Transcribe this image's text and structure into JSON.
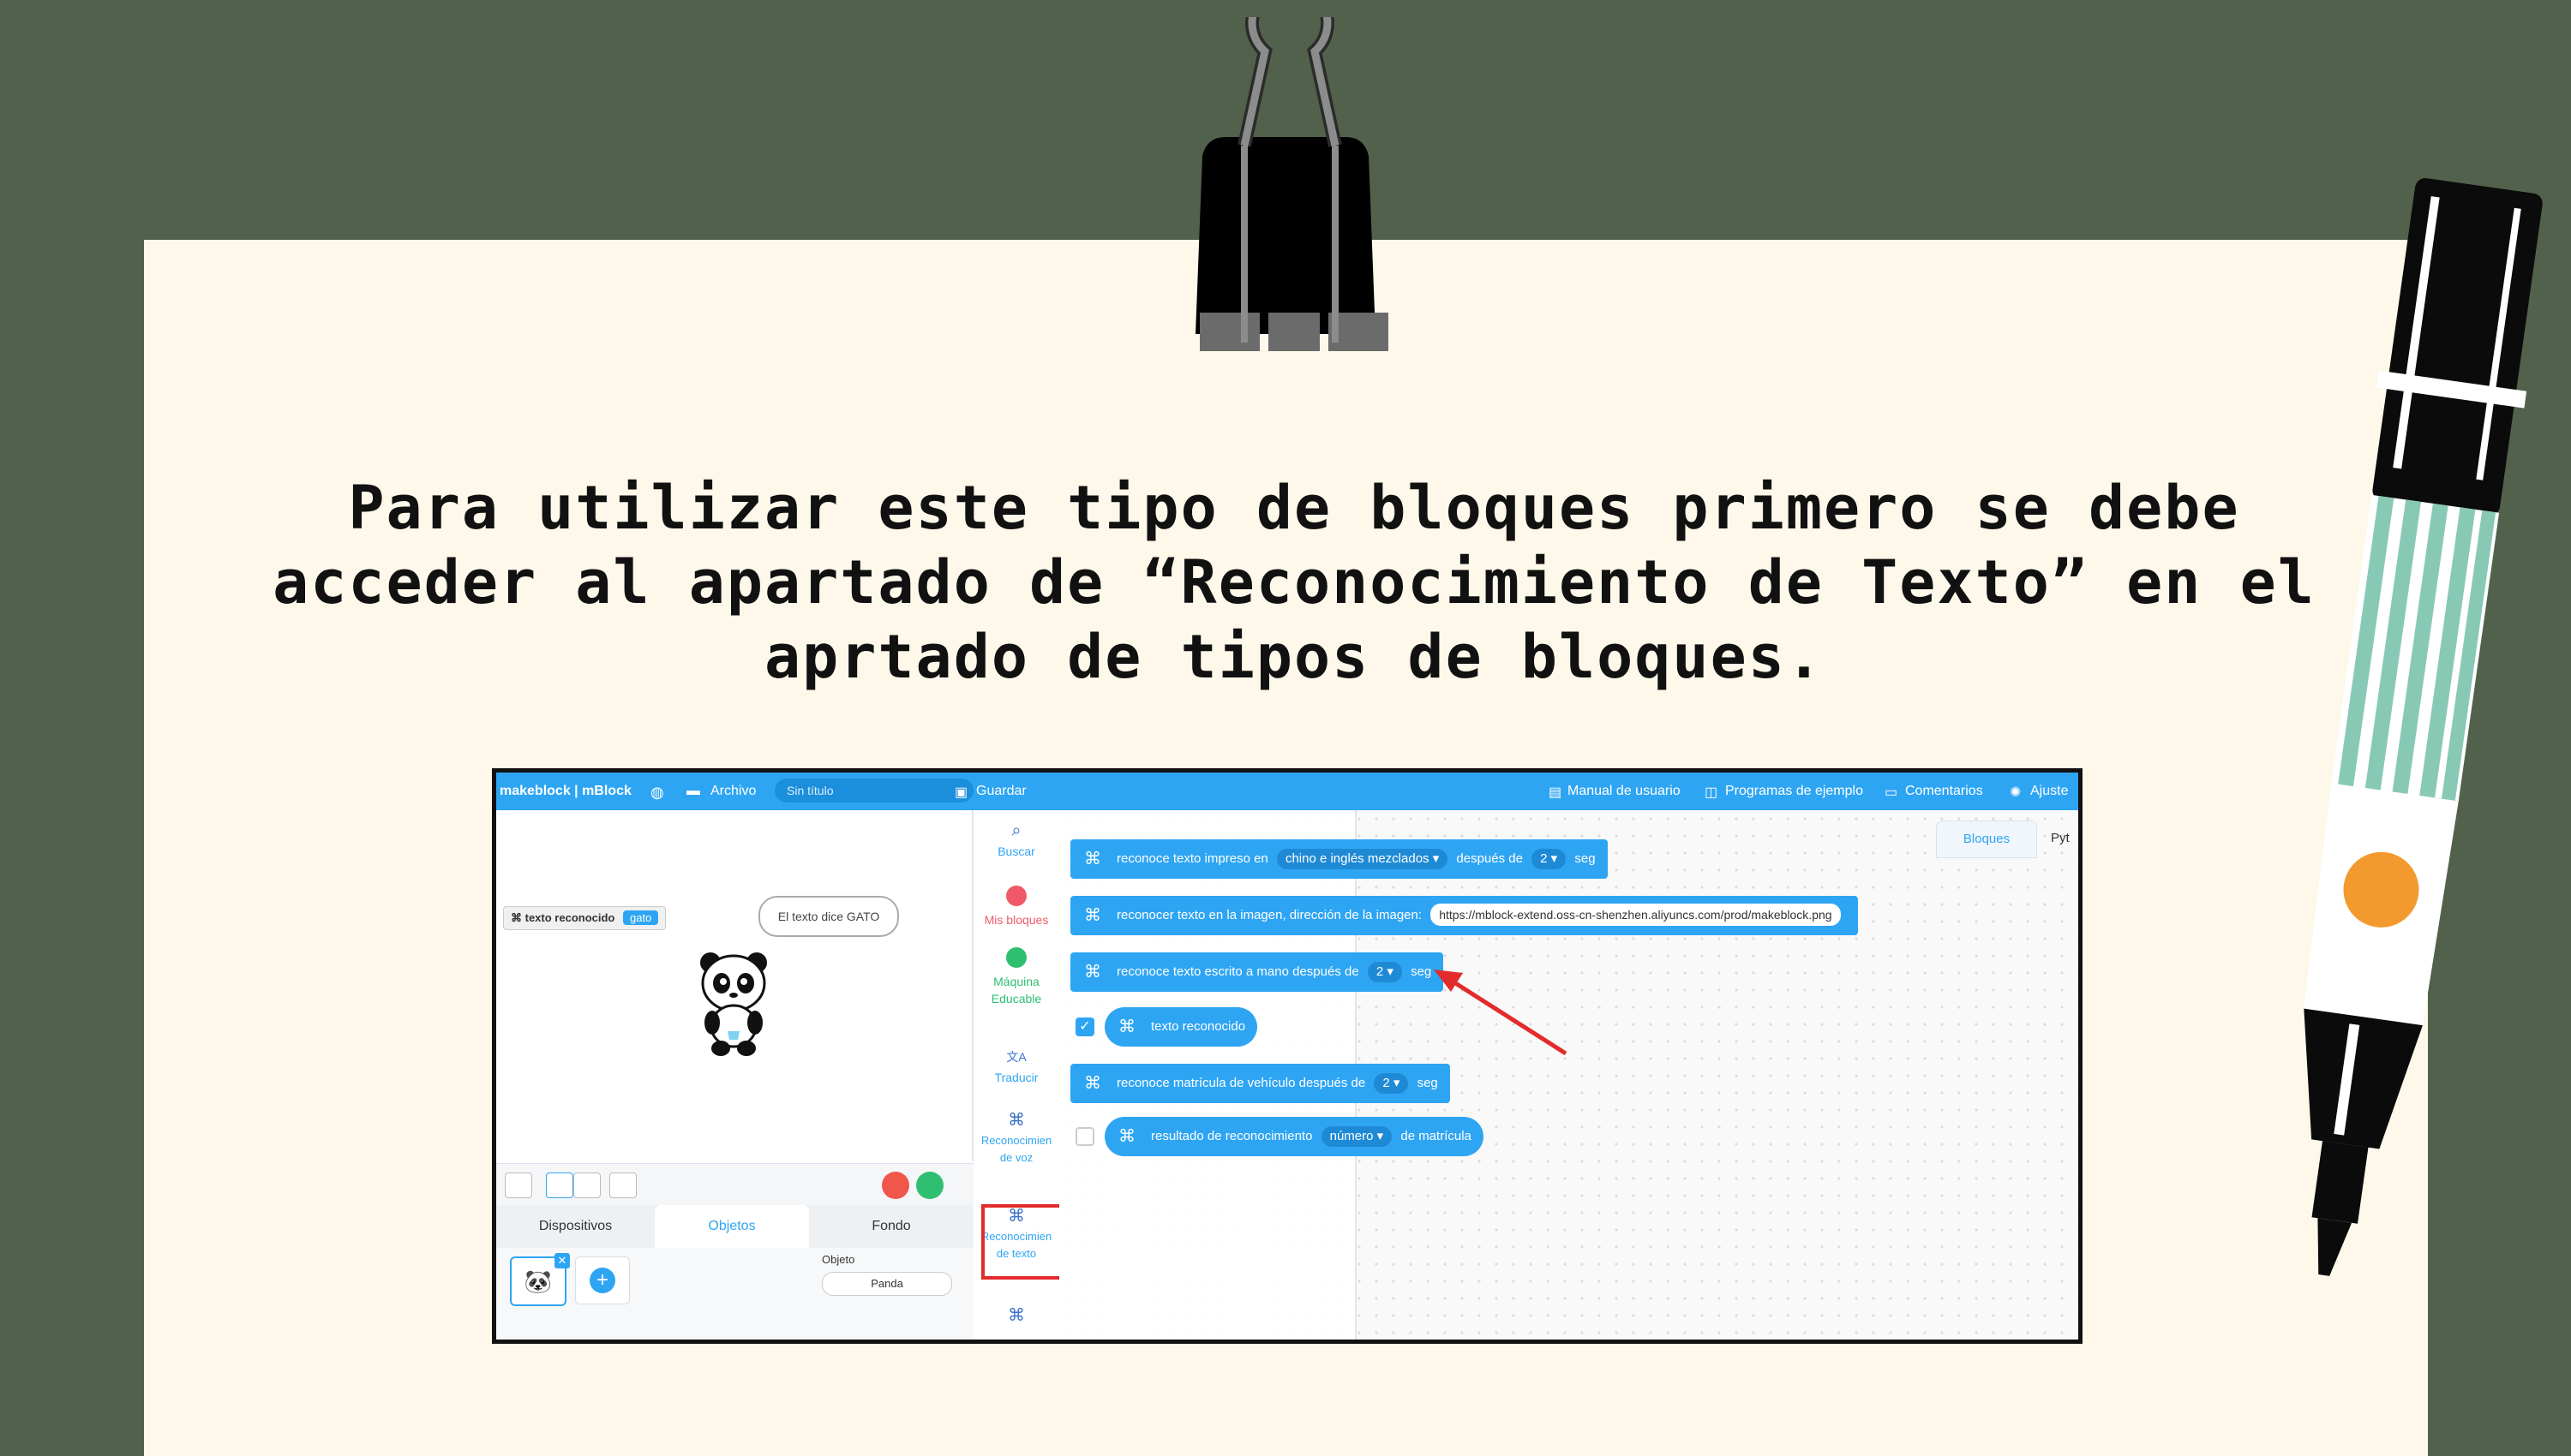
{
  "heading": {
    "line1": "Para utilizar este tipo de bloques primero se debe",
    "line2": "acceder al apartado de “Reconocimiento de Texto” en el",
    "line3": "aprtado de tipos de bloques."
  },
  "colors": {
    "background": "#52614c",
    "paper": "#fef8ea",
    "app_blue": "#2ea5f3",
    "highlight_red": "#e32b2b",
    "marker_stripes": "#88c9b5",
    "marker_dot": "#f29a2e"
  },
  "app": {
    "topbar": {
      "brand": "makeblock | mBlock",
      "file_menu": "Archivo",
      "project_title": "Sin título",
      "save": "Guardar",
      "manual": "Manual de usuario",
      "examples": "Programas de ejemplo",
      "comments": "Comentarios",
      "settings": "Ajuste",
      "icons": [
        "globe-icon",
        "folder-icon",
        "save-icon",
        "book-icon",
        "examples-icon",
        "comment-icon",
        "gear-icon"
      ]
    },
    "stage": {
      "variable_label": "texto reconocido",
      "variable_value": "gato",
      "speech": "El texto dice GATO"
    },
    "panel_tabs": [
      "Dispositivos",
      "Objetos",
      "Fondo"
    ],
    "sprite_panel": {
      "object_label": "Objeto",
      "object_name": "Panda"
    },
    "categories": [
      {
        "label1": "Buscar",
        "label2": "",
        "icon": "search-icon"
      },
      {
        "label1": "Mis bloques",
        "label2": "",
        "color": "#f05a68"
      },
      {
        "label1": "Máquina",
        "label2": "Educable",
        "color": "#2fbf71"
      },
      {
        "label1": "Traducir",
        "label2": "",
        "icon": "translate-icon"
      },
      {
        "label1": "Reconocimien",
        "label2": "de voz",
        "icon": "voice-recognition-icon"
      },
      {
        "label1": "Reconocimien",
        "label2": "de texto",
        "icon": "text-recognition-icon"
      }
    ],
    "blocks": [
      {
        "pre": "reconoce texto impreso en",
        "dd1": "chino e inglés mezclados ▾",
        "mid": "después de",
        "dd2": "2 ▾",
        "post": "seg"
      },
      {
        "pre": "reconocer texto en la imagen, dirección de la imagen:",
        "url": "https://mblock-extend.oss-cn-shenzhen.aliyuncs.com/prod/makeblock.png"
      },
      {
        "pre": "reconoce texto escrito a mano después de",
        "dd2": "2 ▾",
        "post": "seg"
      },
      {
        "reporter": "texto reconocido"
      },
      {
        "pre": "reconoce matrícula de vehículo después de",
        "dd2": "2 ▾",
        "post": "seg"
      },
      {
        "reporter_pre": "resultado de reconocimiento",
        "dd1": "número ▾",
        "post": "de matrícula"
      }
    ],
    "right_tabs": [
      "Bloques",
      "Pyt"
    ]
  }
}
